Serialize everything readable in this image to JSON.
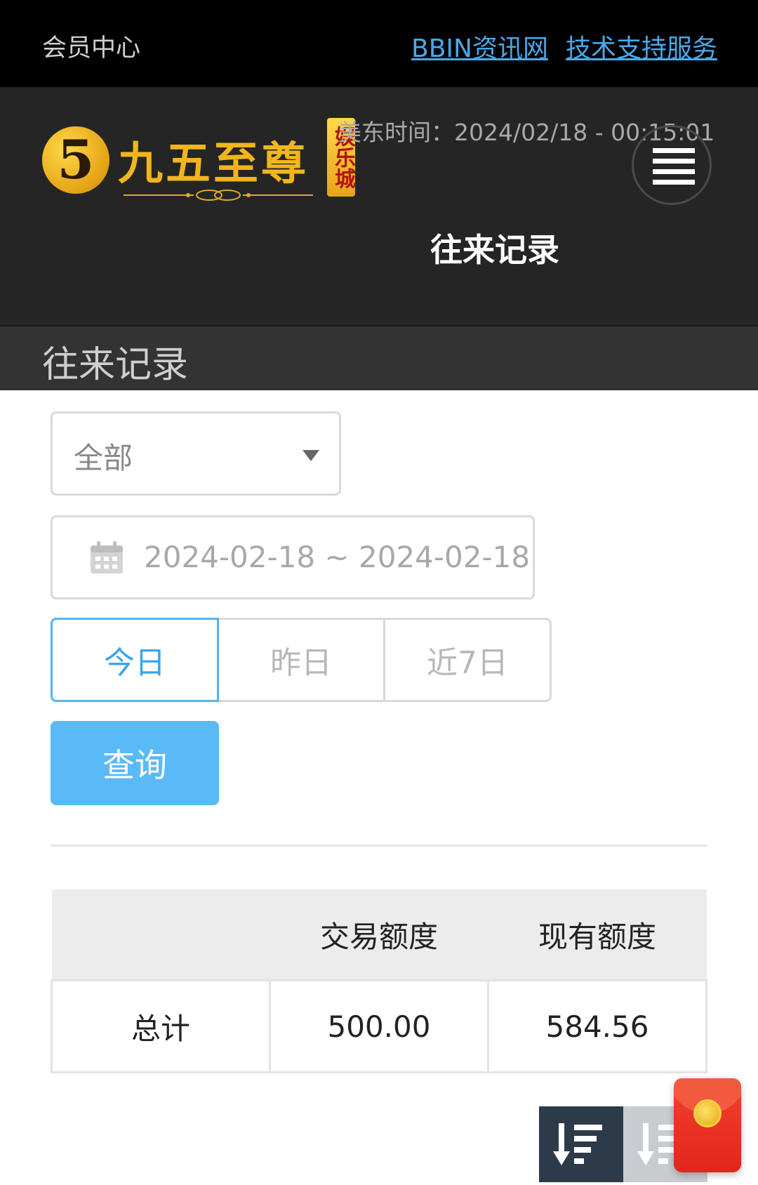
{
  "topbar": {
    "member_center": "会员中心",
    "links": [
      {
        "label": "BBIN资讯网"
      },
      {
        "label": "技术支持服务"
      }
    ]
  },
  "header": {
    "logo": {
      "digit": "5",
      "name": "九五至尊",
      "tag": "娱乐城"
    },
    "clock": "美东时间：2024/02/18 - 00:15:01",
    "page_title": "往来记录"
  },
  "section": {
    "title": "往来记录"
  },
  "form": {
    "type_select": {
      "value": "全部",
      "icon": "triangle-down-icon"
    },
    "date_range": {
      "value": "2024-02-18 ~ 2024-02-18",
      "icon": "calendar-icon"
    },
    "quick_ranges": [
      {
        "label": "今日",
        "active": true
      },
      {
        "label": "昨日",
        "active": false
      },
      {
        "label": "近7日",
        "active": false
      }
    ],
    "query_label": "查询"
  },
  "summary": {
    "headers": [
      "",
      "交易额度",
      "现有额度"
    ],
    "rows": [
      [
        "总计",
        "500.00",
        "584.56"
      ]
    ]
  },
  "floating": {
    "sort_icons": [
      "sort-descending-icon",
      "sort-descending-icon"
    ],
    "redpacket_icon": "red-envelope-icon"
  },
  "colors": {
    "accent": "#53b4f4",
    "query_button": "#5ab9f7",
    "link": "#4aa8e8",
    "logo_gold": "#f2b51c"
  }
}
